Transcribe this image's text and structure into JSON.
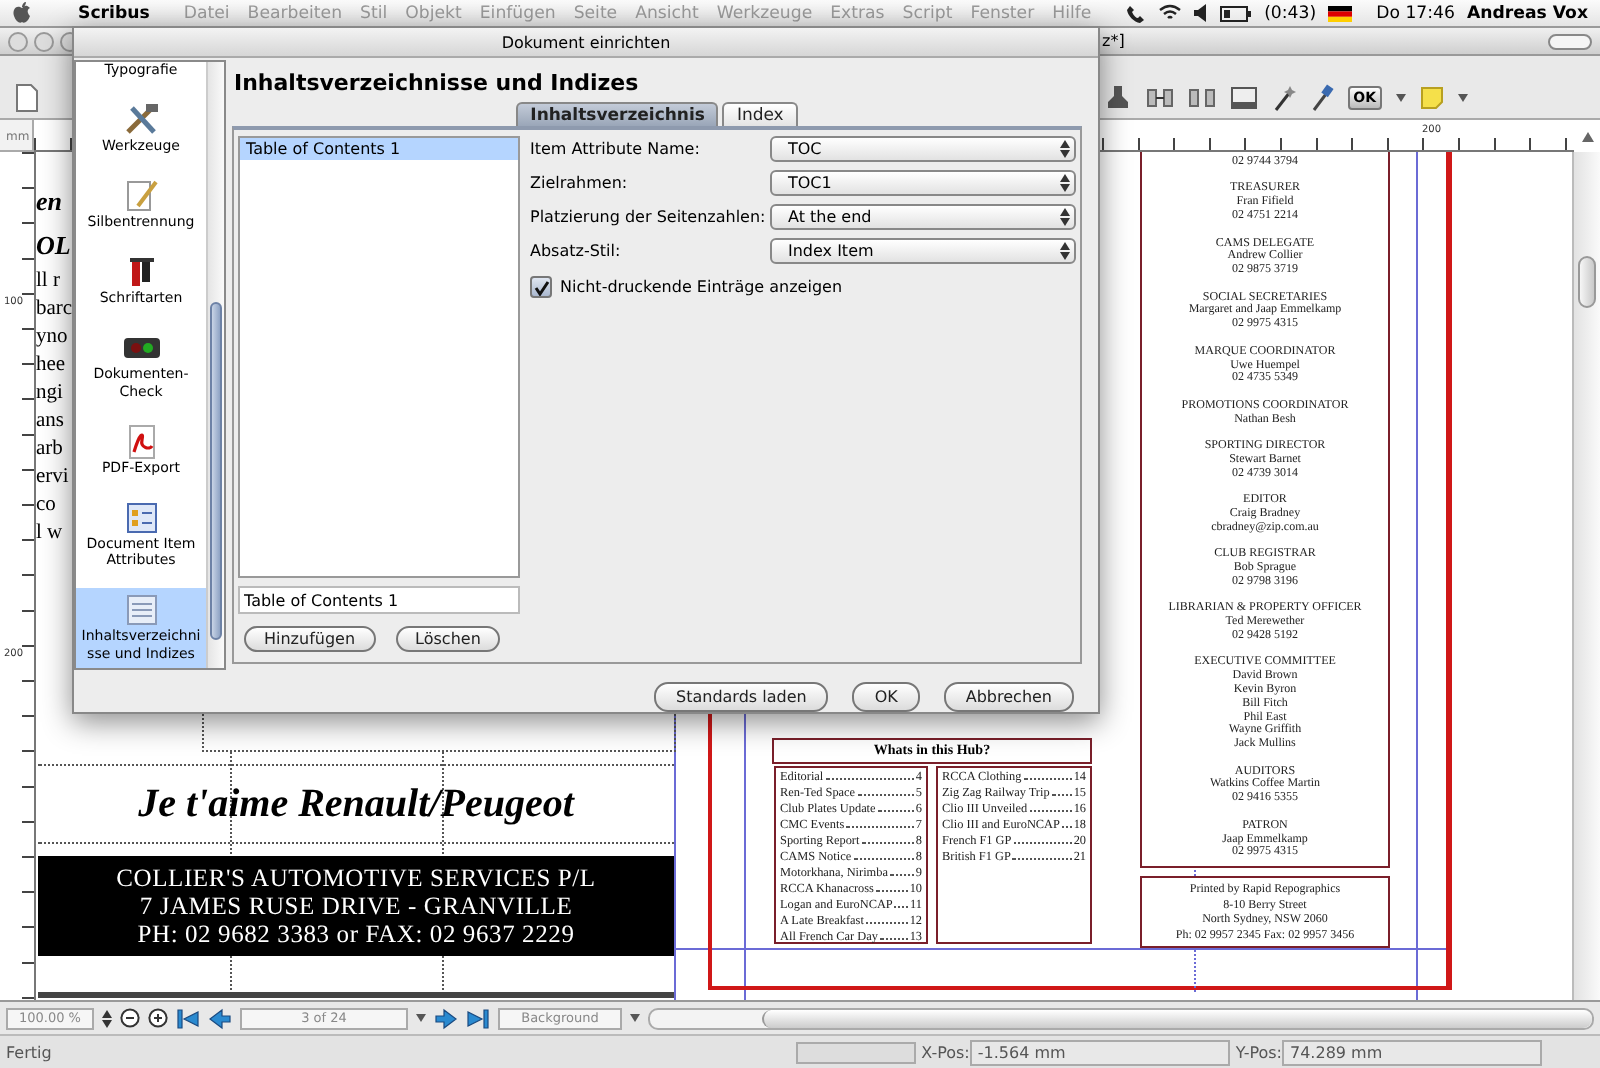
{
  "menu_bar": {
    "app": "Scribus",
    "items": [
      {
        "label": "Datei",
        "disabled": true
      },
      {
        "label": "Bearbeiten",
        "disabled": true
      },
      {
        "label": "Stil",
        "disabled": true
      },
      {
        "label": "Objekt",
        "disabled": true
      },
      {
        "label": "Einfügen",
        "disabled": true
      },
      {
        "label": "Seite",
        "disabled": true
      },
      {
        "label": "Ansicht",
        "disabled": true
      },
      {
        "label": "Werkzeuge",
        "disabled": true
      },
      {
        "label": "Extras",
        "disabled": true
      },
      {
        "label": "Script",
        "disabled": true
      },
      {
        "label": "Fenster",
        "disabled": true
      },
      {
        "label": "Hilfe",
        "disabled": true
      }
    ],
    "battery": "(0:43)",
    "clock": "Do 17:46",
    "user": "Andreas Vox"
  },
  "main_window": {
    "title_fragment": "z*]",
    "toolbar_ok": "OK"
  },
  "document": {
    "ruler_unit": "mm",
    "top_ruler_label": "200",
    "left_ruler_labels": [
      "100",
      "200"
    ],
    "left_text_fragments": [
      {
        "text": "en",
        "kind": "heading"
      },
      {
        "text": "OL",
        "kind": "heading"
      },
      {
        "text": "ll r",
        "kind": "body"
      },
      {
        "text": "barc",
        "kind": "body"
      },
      {
        "text": "yno",
        "kind": "body"
      },
      {
        "text": "hee",
        "kind": "body"
      },
      {
        "text": "ngi",
        "kind": "body"
      },
      {
        "text": "ans",
        "kind": "body"
      },
      {
        "text": "arb",
        "kind": "body"
      },
      {
        "text": "ervi",
        "kind": "body"
      },
      {
        "text": "co",
        "kind": "body"
      },
      {
        "text": "l w",
        "kind": "body"
      }
    ],
    "headline": "Je t'aime Renault/Peugeot",
    "banner_lines": [
      "COLLIER'S AUTOMOTIVE SERVICES P/L",
      "7 JAMES RUSE DRIVE - GRANVILLE",
      "PH: 02 9682 3383 or FAX: 02 9637 2229"
    ],
    "contents_heading": "Whats in this Hub?",
    "contents_columns": [
      [
        {
          "title": "Editorial",
          "page": "4"
        },
        {
          "title": "Ren-Ted Space",
          "page": "5"
        },
        {
          "title": "Club Plates Update",
          "page": "6"
        },
        {
          "title": "CMC Events",
          "page": "7"
        },
        {
          "title": "Sporting Report",
          "page": "8"
        },
        {
          "title": "CAMS Notice",
          "page": "8"
        },
        {
          "title": "Motorkhana, Nirimba",
          "page": "9"
        },
        {
          "title": "RCCA Khanacross",
          "page": "10"
        },
        {
          "title": "Logan and EuroNCAP",
          "page": "11"
        },
        {
          "title": "A Late Breakfast",
          "page": "12"
        },
        {
          "title": "All French Car Day",
          "page": "13"
        }
      ],
      [
        {
          "title": "RCCA Clothing",
          "page": "14"
        },
        {
          "title": "Zig Zag Railway Trip",
          "page": "15"
        },
        {
          "title": "Clio III Unveiled",
          "page": "16"
        },
        {
          "title": "Clio III and EuroNCAP",
          "page": "18"
        },
        {
          "title": "French F1 GP",
          "page": "20"
        },
        {
          "title": "British F1 GP",
          "page": "21"
        }
      ]
    ],
    "committee": [
      {
        "lines": [
          "02 9744 3794"
        ]
      },
      {
        "heading": "TREASURER",
        "lines": [
          "Fran Fifield",
          "02 4751 2214"
        ]
      },
      {
        "heading": "CAMS DELEGATE",
        "lines": [
          "Andrew Collier",
          "02 9875 3719"
        ]
      },
      {
        "heading": "SOCIAL SECRETARIES",
        "lines": [
          "Margaret and Jaap Emmelkamp",
          "02 9975 4315"
        ]
      },
      {
        "heading": "MARQUE COORDINATOR",
        "lines": [
          "Uwe Huempel",
          "02 4735  5349"
        ]
      },
      {
        "heading": "PROMOTIONS COORDINATOR",
        "lines": [
          "Nathan Besh"
        ]
      },
      {
        "heading": "SPORTING DIRECTOR",
        "lines": [
          "Stewart Barnet",
          "02 4739 3014"
        ]
      },
      {
        "heading": "EDITOR",
        "lines": [
          "Craig Bradney",
          "cbradney@zip.com.au"
        ]
      },
      {
        "heading": "CLUB REGISTRAR",
        "lines": [
          "Bob Sprague",
          "02 9798 3196"
        ]
      },
      {
        "heading": "LIBRARIAN & PROPERTY OFFICER",
        "lines": [
          "Ted Merewether",
          "02 9428 5192"
        ]
      },
      {
        "heading": "EXECUTIVE COMMITTEE",
        "lines": [
          "David Brown",
          "Kevin Byron",
          "Bill Fitch",
          "Phil East",
          "Wayne Griffith",
          "Jack Mullins"
        ]
      },
      {
        "heading": "AUDITORS",
        "lines": [
          "Watkins Coffee Martin",
          "02 9416 5355"
        ]
      },
      {
        "heading": "PATRON",
        "lines": [
          "Jaap Emmelkamp",
          "02 9975 4315"
        ]
      }
    ],
    "printer_lines": [
      "Printed by Rapid Repographics",
      "8-10 Berry Street",
      "North Sydney, NSW 2060",
      "Ph: 02 9957 2345  Fax: 02 9957 3456"
    ]
  },
  "dialog": {
    "title": "Dokument einrichten",
    "sidebar": [
      {
        "label": "Typografie",
        "kind": "plain",
        "selected": false
      },
      {
        "label": "Werkzeuge",
        "kind": "tools",
        "selected": false
      },
      {
        "label": "Silbentrennung",
        "kind": "quill",
        "selected": false
      },
      {
        "label": "Schriftarten",
        "kind": "fonts",
        "selected": false
      },
      {
        "label": "Dokumenten-Check",
        "kind": "check",
        "selected": false
      },
      {
        "label": "PDF-Export",
        "kind": "pdf",
        "selected": false
      },
      {
        "label": "Document Item Attributes",
        "kind": "attributes",
        "selected": false
      },
      {
        "label": "Inhaltsverzeichnisse und Indizes",
        "kind": "toc",
        "selected": true
      }
    ],
    "heading": "Inhaltsverzeichnisse und Indizes",
    "tabs": [
      {
        "label": "Inhaltsverzeichnis",
        "selected": true
      },
      {
        "label": "Index",
        "selected": false
      }
    ],
    "list": [
      {
        "label": "Table of Contents 1",
        "selected": true
      }
    ],
    "name_field": {
      "value": "Table of Contents 1"
    },
    "list_buttons": [
      "Hinzufügen",
      "Löschen"
    ],
    "fields": [
      {
        "label": "Item Attribute Name:",
        "value": "TOC"
      },
      {
        "label": "Zielrahmen:",
        "value": "TOC1"
      },
      {
        "label": "Platzierung der Seitenzahlen:",
        "value": "At the end"
      },
      {
        "label": "Absatz-Stil:",
        "value": "Index Item"
      }
    ],
    "checkbox": {
      "label": "Nicht-druckende Einträge anzeigen",
      "checked": true
    },
    "buttons": [
      "Standards laden",
      "OK",
      "Abbrechen"
    ]
  },
  "navigation": {
    "zoom": "100.00 %",
    "page": "3 of 24",
    "layer": "Background"
  },
  "status_bar": {
    "message": "Fertig",
    "progress": {
      "level": 0
    },
    "x_label": "X-Pos:",
    "x_value": "-1.564 mm",
    "y_label": "Y-Pos:",
    "y_value": "74.289 mm"
  }
}
